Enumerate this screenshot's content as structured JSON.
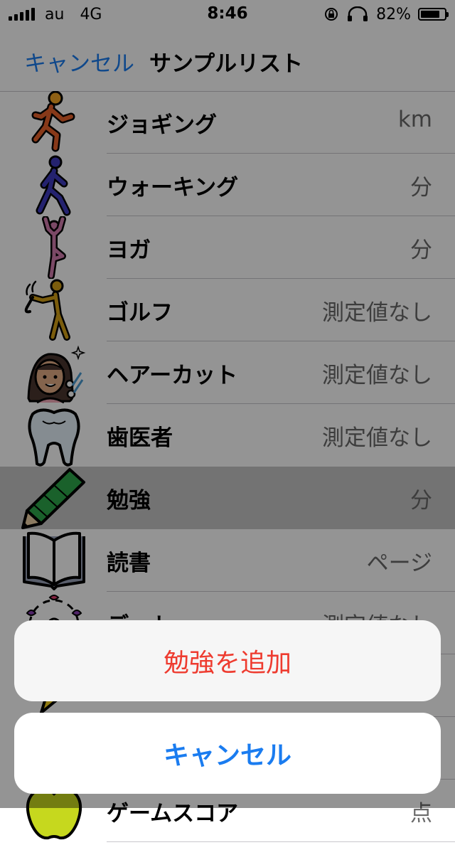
{
  "status_bar": {
    "carrier": "au",
    "network": "4G",
    "time": "8:46",
    "battery_percent": "82%",
    "battery_level": 0.82
  },
  "nav": {
    "cancel_label": "キャンセル",
    "title": "サンプルリスト"
  },
  "rows": [
    {
      "label": "ジョギング",
      "value": "km",
      "icon": "jogging-icon"
    },
    {
      "label": "ウォーキング",
      "value": "分",
      "icon": "walking-icon"
    },
    {
      "label": "ヨガ",
      "value": "分",
      "icon": "yoga-icon"
    },
    {
      "label": "ゴルフ",
      "value": "測定値なし",
      "icon": "golf-icon"
    },
    {
      "label": "ヘアーカット",
      "value": "測定値なし",
      "icon": "haircut-icon"
    },
    {
      "label": "歯医者",
      "value": "測定値なし",
      "icon": "tooth-icon"
    },
    {
      "label": "勉強",
      "value": "分",
      "icon": "pencil-icon"
    },
    {
      "label": "読書",
      "value": "ページ",
      "icon": "book-icon"
    },
    {
      "label": "デート",
      "value": "測定値なし",
      "icon": "date-icon"
    },
    {
      "label": "ゲームスコア",
      "value": "点",
      "icon": "apple-icon"
    }
  ],
  "action_sheet": {
    "action_label": "勉強を追加",
    "cancel_label": "キャンセル"
  },
  "colors": {
    "accent": "#1a7cf0",
    "destructive": "#ee3b2f"
  }
}
